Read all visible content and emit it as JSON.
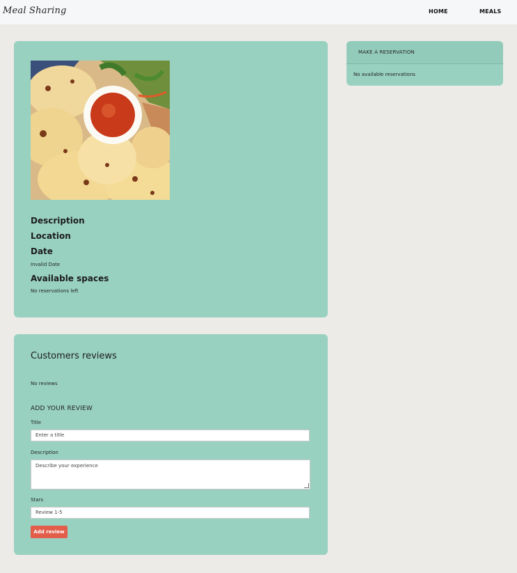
{
  "nav": {
    "brand": "Meal Sharing",
    "links": [
      {
        "label": "HOME"
      },
      {
        "label": "MEALS"
      }
    ]
  },
  "meal": {
    "photo_icon": "pupusa-plate-photo",
    "description_label": "Description",
    "location_label": "Location",
    "date_label": "Date",
    "date_value": "Invalid Date",
    "spaces_label": "Available spaces",
    "spaces_value": "No reservations left"
  },
  "reservation": {
    "title": "MAKE A RESERVATION",
    "empty_text": "No available reservations"
  },
  "reviews": {
    "title": "Customers reviews",
    "empty_text": "No reviews",
    "add_heading": "ADD YOUR REVIEW",
    "title_label": "Title",
    "title_placeholder": "Enter a title",
    "description_label": "Description",
    "description_placeholder": "Describe your experience",
    "stars_label": "Stars",
    "stars_placeholder": "Review 1-5",
    "submit_label": "Add review"
  },
  "colors": {
    "card": "#99d1c1",
    "page": "#ecebe7",
    "button": "#e25d4a"
  }
}
